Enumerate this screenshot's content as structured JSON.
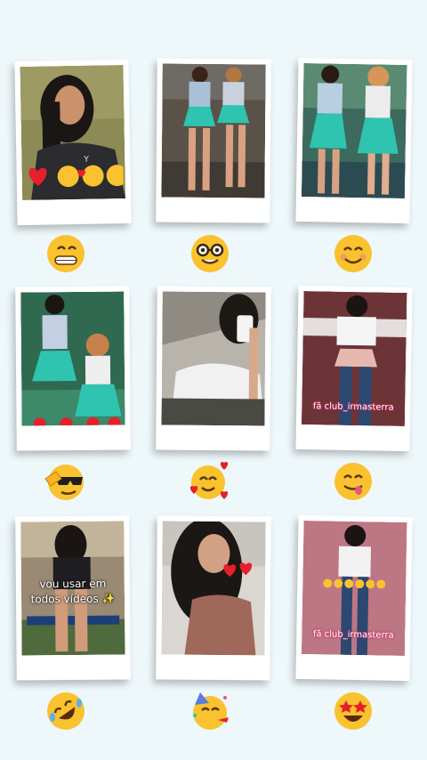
{
  "colors": {
    "background": "#eef8fb",
    "card": "#ffffff",
    "emoji_yellow": "#f9c22e",
    "heart_red": "#e5202a",
    "skirt_teal": "#2ec4b0"
  },
  "cards": [
    {
      "overlay": "",
      "reaction_icon": "grinning-face-icon"
    },
    {
      "overlay": "",
      "reaction_icon": "nerd-face-icon"
    },
    {
      "overlay": "",
      "reaction_icon": "smiling-face-icon"
    },
    {
      "overlay": "",
      "reaction_icon": "salute-sunglasses-face-icon"
    },
    {
      "overlay": "",
      "reaction_icon": "smiling-face-with-hearts-icon"
    },
    {
      "overlay": "fã club_irmasterra",
      "reaction_icon": "face-savoring-food-icon"
    },
    {
      "overlay": "vou usar em todos vídeos ✨",
      "reaction_icon": "rolling-laughing-face-icon"
    },
    {
      "overlay": "",
      "reaction_icon": "partying-face-icon"
    },
    {
      "overlay": "fã club_irmasterra",
      "reaction_icon": "star-struck-face-icon"
    }
  ]
}
